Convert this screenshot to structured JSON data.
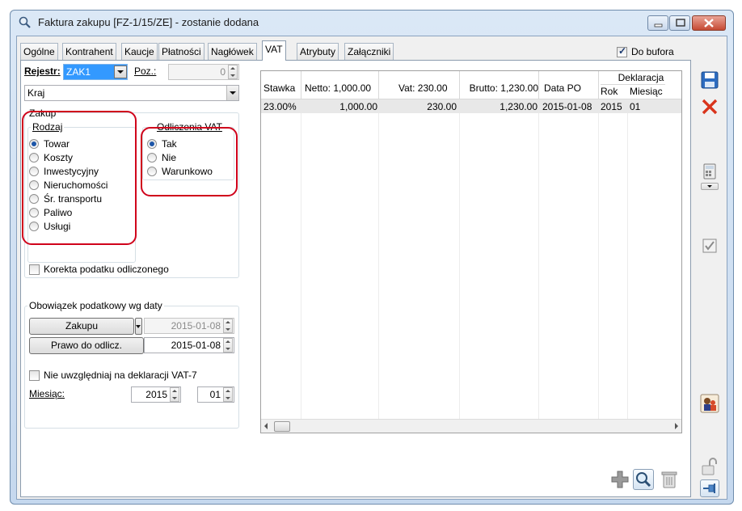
{
  "window": {
    "title": "Faktura zakupu [FZ-1/15/ZE] - zostanie dodana"
  },
  "tabs": [
    {
      "label": "Ogólne"
    },
    {
      "label": "Kontrahent"
    },
    {
      "label": "Kaucje"
    },
    {
      "label": "Płatności"
    },
    {
      "label": "Nagłówek"
    },
    {
      "label": "VAT"
    },
    {
      "label": "Atrybuty"
    },
    {
      "label": "Załączniki"
    }
  ],
  "active_tab": "VAT",
  "do_bufora": {
    "label": "Do bufora",
    "checked": true
  },
  "rejestr": {
    "label": "Rejestr:",
    "value": "ZAK1"
  },
  "poz": {
    "label": "Poz.:",
    "value": "0"
  },
  "kraj": {
    "value": "Kraj"
  },
  "zakup": {
    "legend": "Zakup",
    "rodzaj": {
      "legend": "Rodzaj",
      "options": [
        "Towar",
        "Koszty",
        "Inwestycyjny",
        "Nieruchomości",
        "Śr. transportu",
        "Paliwo",
        "Usługi"
      ],
      "selected": "Towar"
    },
    "odliczenia": {
      "legend": "Odliczenia VAT",
      "options": [
        "Tak",
        "Nie",
        "Warunkowo"
      ],
      "selected": "Tak"
    }
  },
  "korekta": {
    "label": "Korekta podatku odliczonego",
    "checked": false
  },
  "obowiazek": {
    "legend": "Obowiązek podatkowy wg daty",
    "zakupu_label": "Zakupu",
    "zakupu_date": "2015-01-08",
    "prawo_label": "Prawo do odlicz.",
    "prawo_date": "2015-01-08"
  },
  "nie_uwzgledniaj": {
    "label": "Nie uwzględniaj na deklaracji VAT-7",
    "checked": false
  },
  "miesiac": {
    "label": "Miesiąc:",
    "year": "2015",
    "month": "01"
  },
  "grid": {
    "headers": {
      "stawka": "Stawka",
      "netto": "Netto: 1,000.00",
      "vat": "Vat: 230.00",
      "brutto": "Brutto: 1,230.00",
      "data_po": "Data PO",
      "deklaracja": "Deklaracja",
      "rok": "Rok",
      "miesiac": "Miesiąc"
    },
    "rows": [
      {
        "stawka": "23.00%",
        "netto": "1,000.00",
        "vat": "230.00",
        "brutto": "1,230.00",
        "data_po": "2015-01-08",
        "rok": "2015",
        "miesiac": "01"
      }
    ]
  },
  "colors": {
    "highlight": "#d0021b",
    "selection": "#3399ff"
  }
}
